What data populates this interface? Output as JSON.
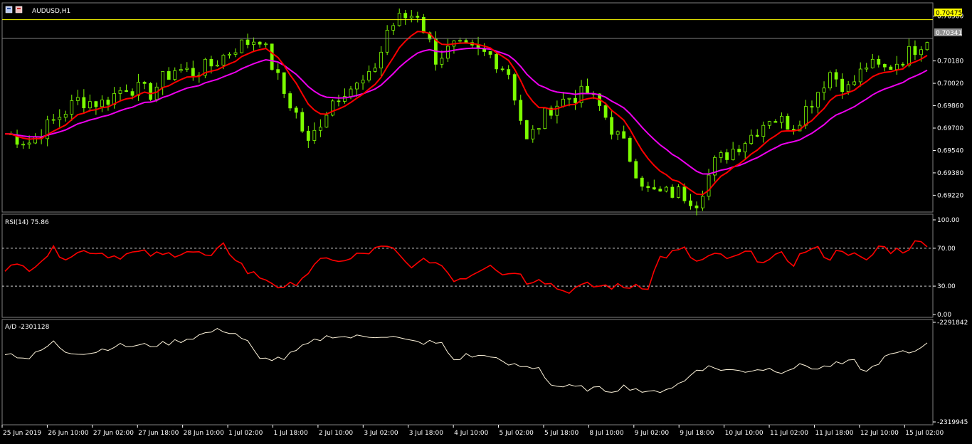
{
  "window": {
    "symbol_title": "AUDUSD,H1"
  },
  "colors": {
    "background": "#000000",
    "panel_border": "#808080",
    "candle": "#7CFC00",
    "ma_fast": "#FF0000",
    "ma_slow": "#EE00EE",
    "rsi_line": "#FF0000",
    "ad_line": "#FFF5DC",
    "ask_line": "#FFFF00",
    "bid_line": "#808080",
    "ask_label_bg": "#FFFF00",
    "bid_label_bg": "#909090"
  },
  "chart_data": [
    {
      "type": "candlestick",
      "title": "AUDUSD,H1",
      "ylim": [
        0.691,
        0.70595
      ],
      "y_ticks": [
        "0.70500",
        "0.70341",
        "0.70180",
        "0.70020",
        "0.69860",
        "0.69700",
        "0.69540",
        "0.69380",
        "0.69220"
      ],
      "ask_price": "0.70475",
      "bid_price": "0.70341",
      "series": [
        {
          "name": "",
          "kind": "close_path",
          "x": [
            0,
            4,
            8,
            12,
            16,
            20,
            24,
            26,
            28,
            31,
            34,
            38,
            42,
            44,
            46,
            48,
            50,
            52,
            54,
            56,
            58,
            60,
            62,
            63,
            65,
            68,
            71,
            74,
            77,
            80,
            83,
            86,
            90,
            93,
            96,
            98,
            99,
            100,
            102,
            104,
            106,
            108,
            111,
            114,
            117,
            120,
            123,
            126,
            130
          ],
          "y": [
            0.6966,
            0.696,
            0.6975,
            0.699,
            0.6988,
            0.7,
            0.6995,
            0.7005,
            0.7012,
            0.701,
            0.7015,
            0.7028,
            0.7035,
            0.7015,
            0.6995,
            0.698,
            0.6958,
            0.6975,
            0.699,
            0.6998,
            0.7,
            0.7005,
            0.7025,
            0.704,
            0.7048,
            0.7052,
            0.702,
            0.7028,
            0.7025,
            0.7022,
            0.701,
            0.696,
            0.6985,
            0.6992,
            0.6995,
            0.6985,
            0.6978,
            0.697,
            0.6958,
            0.694,
            0.6925,
            0.6923,
            0.6924,
            0.6918,
            0.6945,
            0.6955,
            0.6965,
            0.6978,
            0.6972
          ],
          "x_tail": [
            133,
            136,
            139,
            142,
            145,
            148,
            152
          ],
          "y_tail": [
            0.699,
            0.701,
            0.6998,
            0.7015,
            0.7012,
            0.702,
            0.7035
          ]
        },
        {
          "name": "",
          "kind": "ma_fast",
          "color_key": "ma_fast"
        },
        {
          "name": "",
          "kind": "ma_slow",
          "color_key": "ma_slow"
        }
      ],
      "candle_count": 152
    },
    {
      "type": "line",
      "title": "RSI(14) 75.86",
      "ylim": [
        0,
        100
      ],
      "y_ticks": [
        "100.00",
        "70.00",
        "30.00",
        "0.00"
      ],
      "levels": [
        70,
        30
      ],
      "series": [
        {
          "name": "RSI(14)",
          "x": [
            0,
            4,
            8,
            10,
            14,
            18,
            22,
            26,
            30,
            34,
            36,
            38,
            40,
            42,
            44,
            46,
            48,
            50,
            52,
            54,
            56,
            58,
            62,
            64,
            66,
            68,
            70,
            72,
            74,
            76,
            78,
            80,
            82,
            84,
            86,
            88,
            90,
            92,
            96,
            100,
            102,
            104,
            106,
            108,
            110,
            112,
            114,
            116,
            118,
            120,
            122,
            124,
            126,
            128,
            130,
            132,
            134,
            136,
            138,
            140,
            142,
            144,
            146,
            148,
            150,
            152
          ],
          "y": [
            50,
            50,
            68,
            62,
            68,
            62,
            65,
            62,
            68,
            60,
            72,
            60,
            45,
            40,
            35,
            25,
            35,
            45,
            55,
            60,
            55,
            62,
            70,
            68,
            55,
            52,
            58,
            52,
            38,
            40,
            48,
            55,
            42,
            47,
            35,
            40,
            32,
            25,
            30,
            30,
            28,
            32,
            30,
            60,
            65,
            68,
            55,
            60,
            62,
            58,
            65,
            60,
            57,
            62,
            55,
            68,
            68,
            60,
            70,
            62,
            55,
            72,
            68,
            68,
            75,
            76
          ]
        }
      ]
    },
    {
      "type": "line",
      "title": "A/D -2301128",
      "ylim": [
        -2319945,
        -2291842
      ],
      "y_ticks": [
        "-2291842",
        "-2319945"
      ],
      "series": [
        {
          "name": "A/D",
          "x": [
            0,
            4,
            8,
            10,
            14,
            18,
            22,
            26,
            30,
            34,
            36,
            38,
            40,
            42,
            44,
            46,
            48,
            50,
            52,
            54,
            56,
            58,
            62,
            64,
            66,
            68,
            70,
            72,
            74,
            76,
            78,
            80,
            82,
            84,
            86,
            88,
            90,
            92,
            96,
            100,
            102,
            104,
            106,
            108,
            110,
            112,
            114,
            116,
            118,
            120,
            122,
            124,
            126,
            128,
            130,
            132,
            134,
            136,
            138,
            140,
            142,
            144,
            146,
            148,
            150,
            152
          ],
          "y": [
            -2300500,
            -2302000,
            -2297500,
            -2300000,
            -2300500,
            -2298500,
            -2298500,
            -2298000,
            -2296500,
            -2294500,
            -2294000,
            -2295000,
            -2297500,
            -2302500,
            -2302000,
            -2302000,
            -2300000,
            -2298000,
            -2296500,
            -2295500,
            -2296000,
            -2296000,
            -2295500,
            -2296000,
            -2297000,
            -2297500,
            -2297500,
            -2298000,
            -2302500,
            -2301200,
            -2301500,
            -2301000,
            -2303500,
            -2304000,
            -2304500,
            -2304500,
            -2309500,
            -2310000,
            -2310500,
            -2311000,
            -2310000,
            -2310500,
            -2312000,
            -2311000,
            -2310000,
            -2308500,
            -2305000,
            -2304500,
            -2305000,
            -2305500,
            -2305500,
            -2305000,
            -2305000,
            -2305500,
            -2304500,
            -2304000,
            -2305000,
            -2304000,
            -2303500,
            -2303000,
            -2306000,
            -2303000,
            -2301000,
            -2300500,
            -2300000,
            -2297000
          ]
        }
      ]
    }
  ],
  "x_axis": {
    "labels": [
      "25 Jun 2019",
      "26 Jun 10:00",
      "27 Jun 02:00",
      "27 Jun 18:00",
      "28 Jun 10:00",
      "1 Jul 02:00",
      "1 Jul 18:00",
      "2 Jul 10:00",
      "3 Jul 02:00",
      "3 Jul 18:00",
      "4 Jul 10:00",
      "5 Jul 02:00",
      "5 Jul 18:00",
      "8 Jul 10:00",
      "9 Jul 02:00",
      "9 Jul 18:00",
      "10 Jul 10:00",
      "11 Jul 02:00",
      "11 Jul 18:00",
      "12 Jul 10:00",
      "15 Jul 02:00"
    ]
  }
}
